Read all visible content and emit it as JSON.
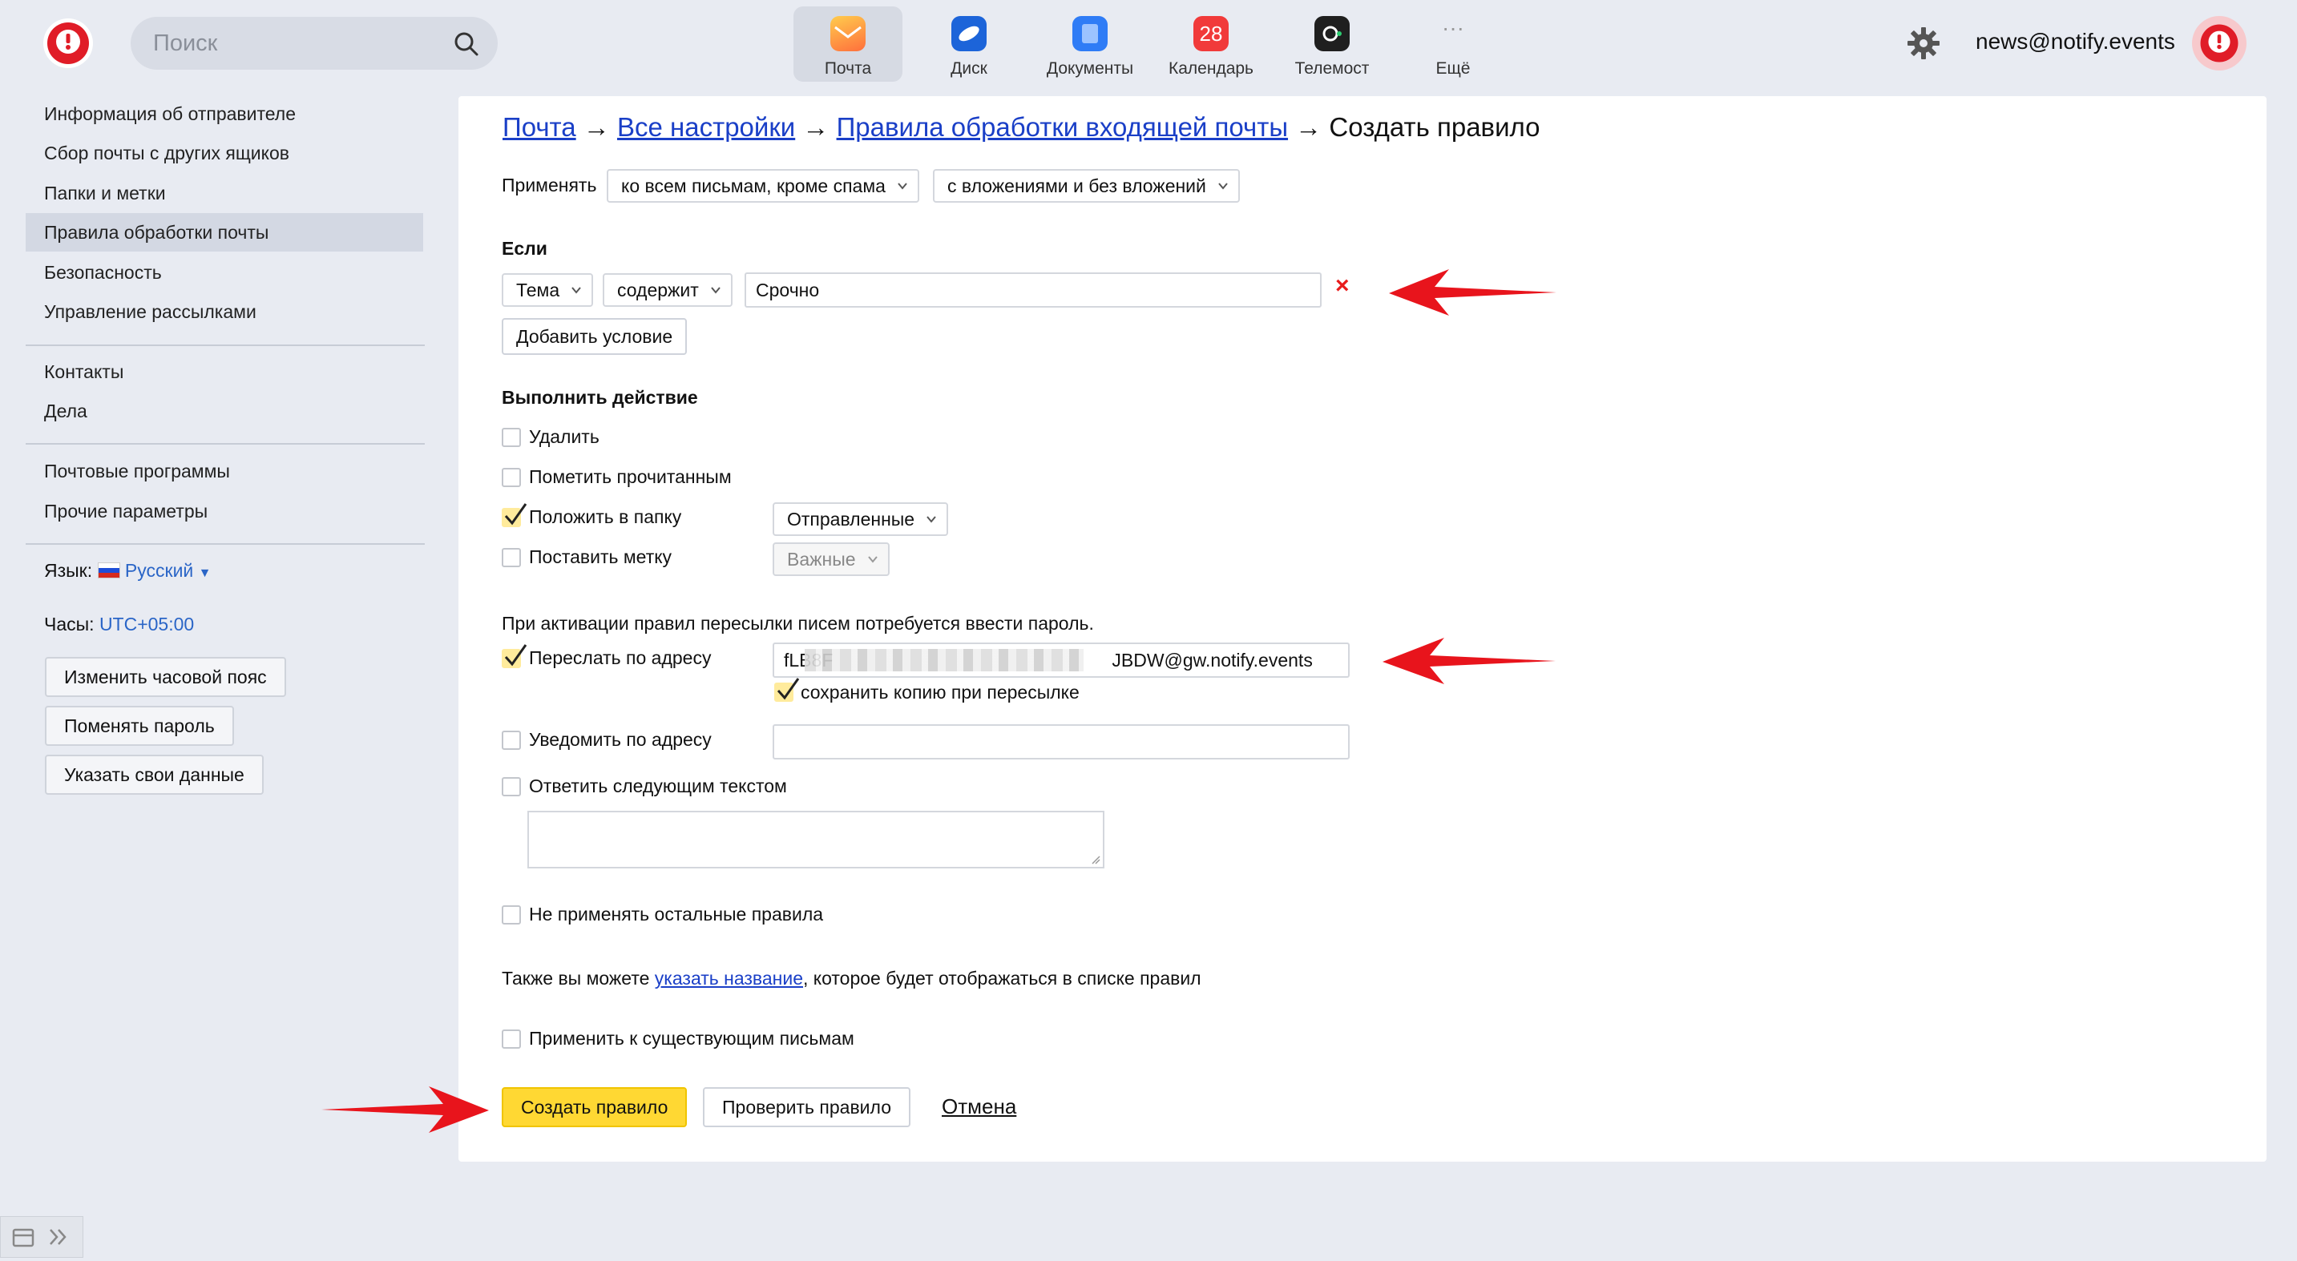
{
  "header": {
    "search_placeholder": "Поиск",
    "services": [
      {
        "label": "Почта",
        "icon": "mail-icon",
        "color": "#ff9f1a"
      },
      {
        "label": "Диск",
        "icon": "disk-icon",
        "color": "#1c64d9"
      },
      {
        "label": "Документы",
        "icon": "documents-icon",
        "color": "#2f7cf6"
      },
      {
        "label": "Календарь",
        "icon": "calendar-icon",
        "color": "#f13a3a",
        "badge": "28"
      },
      {
        "label": "Телемост",
        "icon": "telemost-icon",
        "color": "#1f1f1f"
      },
      {
        "label": "Ещё",
        "icon": "more-icon",
        "color": "#999999"
      }
    ],
    "user_email": "news@notify.events"
  },
  "sidebar": {
    "group1": [
      "Информация об отправителе",
      "Сбор почты с других ящиков",
      "Папки и метки",
      "Правила обработки почты",
      "Безопасность",
      "Управление рассылками"
    ],
    "group2": [
      "Контакты",
      "Дела"
    ],
    "group3": [
      "Почтовые программы",
      "Прочие параметры"
    ],
    "language_label": "Язык:",
    "language_value": "Русский",
    "clock_label": "Часы:",
    "clock_value": "UTC+05:00",
    "buttons": [
      "Изменить часовой пояс",
      "Поменять пароль",
      "Указать свои данные"
    ]
  },
  "breadcrumb": {
    "item1": "Почта",
    "item2": "Все настройки",
    "item3": "Правила обработки входящей почты",
    "current": "Создать правило",
    "separator": "→"
  },
  "apply": {
    "label": "Применять",
    "scope": "ко всем письмам, кроме спама",
    "attachments": "с вложениями и без вложений"
  },
  "condition": {
    "heading": "Если",
    "field": "Тема",
    "operator": "содержит",
    "value": "Срочно",
    "remove": "×",
    "add_label": "Добавить условие"
  },
  "actions": {
    "heading": "Выполнить действие",
    "delete": "Удалить",
    "mark_read": "Пометить прочитанным",
    "move_to_folder": "Положить в папку",
    "folder": "Отправленные",
    "set_label": "Поставить метку",
    "label_value": "Важные",
    "password_note": "При активации правил пересылки писем потребуется ввести пароль.",
    "forward": "Переслать по адресу",
    "forward_prefix": "fLB8F",
    "forward_suffix": "JBDW@gw.notify.events",
    "keep_copy": "сохранить копию при пересылке",
    "notify": "Уведомить по адресу",
    "reply": "Ответить следующим текстом",
    "stop_rules": "Не применять остальные правила",
    "name_note_prefix": "Также вы можете ",
    "name_note_link": "указать название",
    "name_note_suffix": ", которое будет отображаться в списке правил",
    "apply_existing": "Применить к существующим письмам"
  },
  "footer_buttons": {
    "create": "Создать правило",
    "check": "Проверить правило",
    "cancel": "Отмена"
  },
  "colors": {
    "accent": "#ffd833",
    "link": "#1a3fc7",
    "arrow": "#e8141c"
  }
}
